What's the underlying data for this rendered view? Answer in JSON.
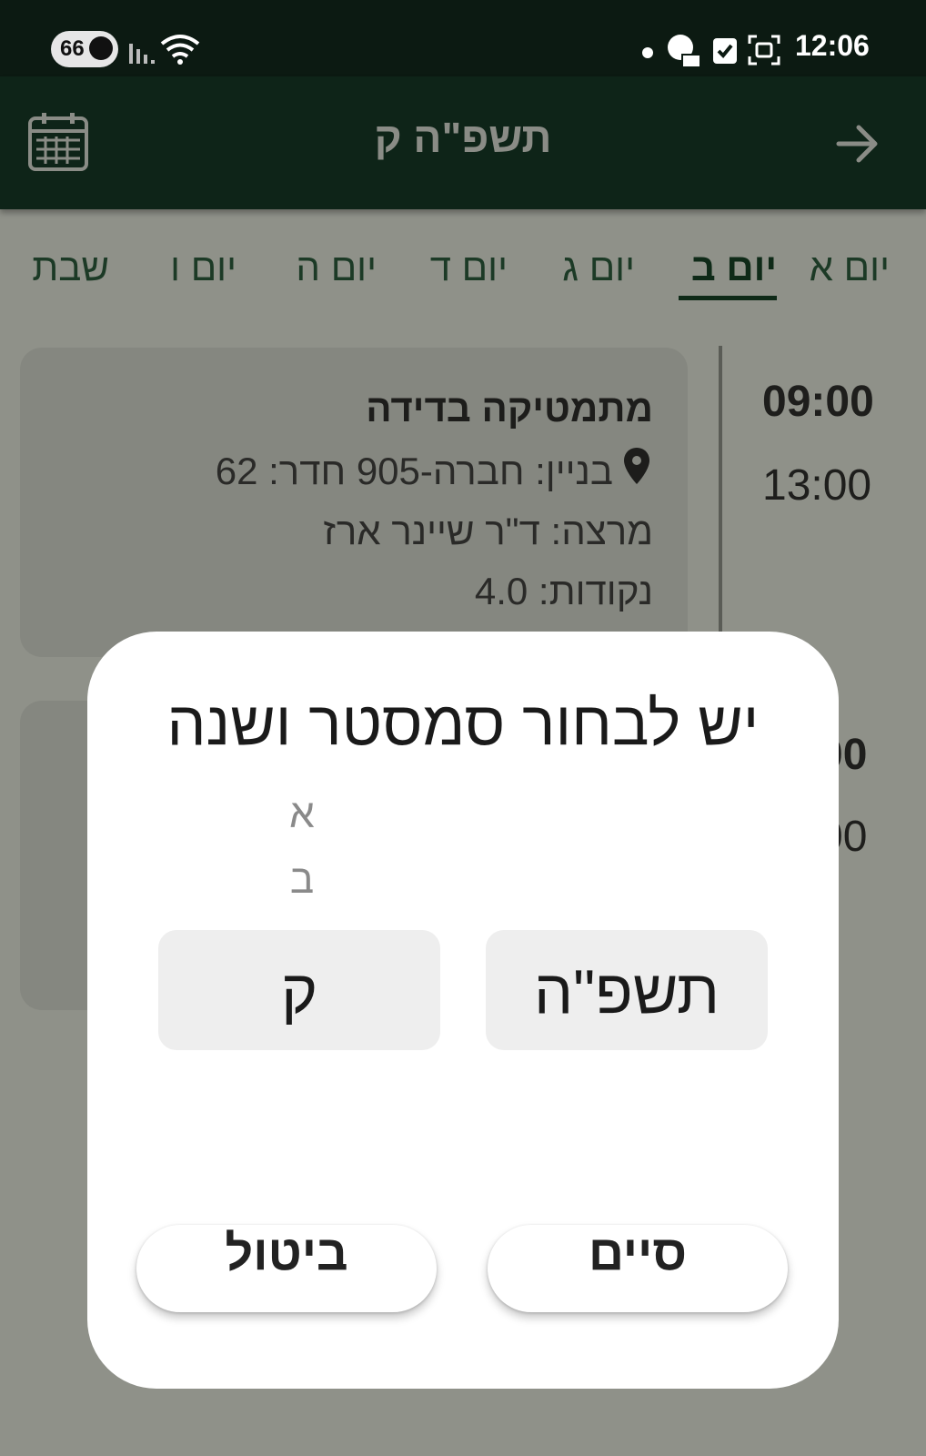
{
  "status_bar": {
    "battery": "66",
    "time": "12:06"
  },
  "app_bar": {
    "title": "תשפ\"ה ק",
    "calendar_icon": "calendar-icon",
    "back_icon": "arrow-right-icon"
  },
  "tabs": [
    {
      "label": "יום א"
    },
    {
      "label": "יום ב"
    },
    {
      "label": "יום ג"
    },
    {
      "label": "יום ד"
    },
    {
      "label": "יום ה"
    },
    {
      "label": "יום ו"
    },
    {
      "label": "שבת"
    }
  ],
  "active_tab": "יום ב",
  "schedule": {
    "course": {
      "title": "מתמטיקה בדידה",
      "location": "בניין: חברה-905 חדר: 62",
      "lecturer": "מרצה: ד\"ר שיינר ארז",
      "credits": "נקודות: 4.0",
      "start": "09:00",
      "end": "13:00"
    }
  },
  "dialog": {
    "title": "יש לבחור סמסטר ושנה",
    "semester_options": [
      "א",
      "ב"
    ],
    "semester_selected": "ק",
    "year_selected": "תשפ\"ה",
    "done_label": "סיים",
    "cancel_label": "ביטול"
  },
  "colors": {
    "app_bar": "#0e2418",
    "scrim_bg": "#8f9189",
    "dialog_bg": "#ffffff"
  }
}
